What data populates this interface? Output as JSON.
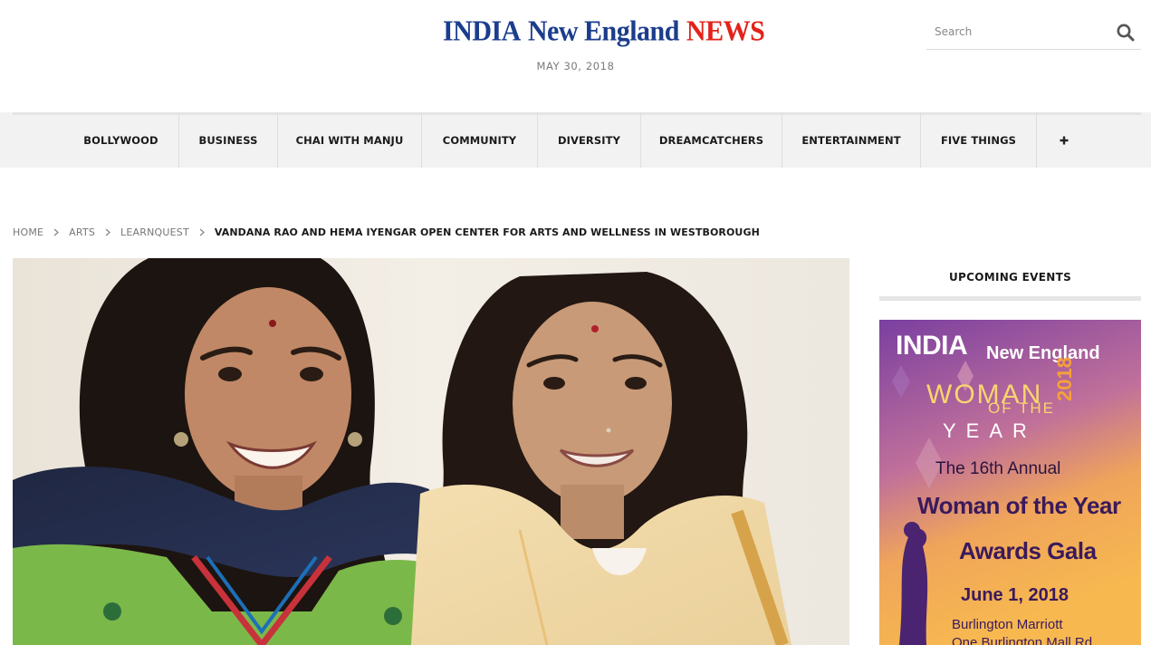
{
  "header": {
    "logo": {
      "part1": "INDIA",
      "part2": "New England",
      "part3": "NEWS"
    },
    "date": "MAY 30, 2018",
    "search": {
      "placeholder": "Search",
      "icon": "search-icon"
    }
  },
  "nav": {
    "items": [
      {
        "label": "BOLLYWOOD"
      },
      {
        "label": "BUSINESS"
      },
      {
        "label": "CHAI WITH MANJU"
      },
      {
        "label": "COMMUNITY"
      },
      {
        "label": "DIVERSITY"
      },
      {
        "label": "DREAMCATCHERS"
      },
      {
        "label": "ENTERTAINMENT"
      },
      {
        "label": "FIVE THINGS"
      }
    ],
    "more_icon": "plus-icon"
  },
  "breadcrumb": {
    "items": [
      "HOME",
      "ARTS",
      "LEARNQUEST"
    ],
    "current": "VANDANA RAO AND HEMA IYENGAR OPEN CENTER FOR ARTS AND WELLNESS IN WESTBOROUGH",
    "separator_icon": "chevron-right-icon"
  },
  "sidebar": {
    "title": "UPCOMING EVENTS",
    "ad": {
      "brand_line1": "INDIA",
      "brand_line2": "New England",
      "woman": "WOMAN",
      "of_the": "OF THE",
      "year": "YEAR",
      "year_number": "2018",
      "annual": "The 16th Annual",
      "headline1": "Woman of the Year",
      "headline2": "Awards Gala",
      "date": "June 1, 2018",
      "venue1": "Burlington Marriott",
      "venue2": "One Burlington Mall Rd",
      "colors": {
        "purple": "#5b2a86",
        "orange": "#f6a13a",
        "gold": "#f9d56e"
      }
    }
  },
  "colors": {
    "logo_blue": "#1c3d8c",
    "logo_red": "#e2231a",
    "nav_bg": "#f2f2f2"
  }
}
